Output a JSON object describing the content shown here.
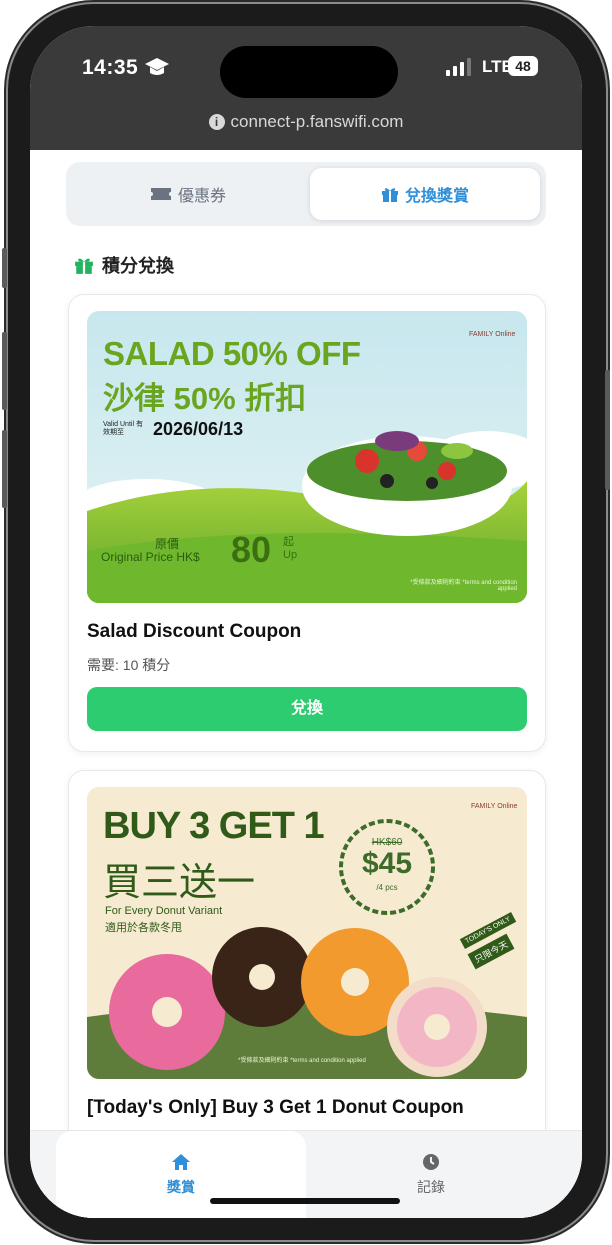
{
  "status_bar": {
    "time": "14:35",
    "network": "LTE",
    "battery": "48"
  },
  "browser": {
    "url": "connect-p.fanswifi.com"
  },
  "tabs": [
    {
      "label": "優惠券",
      "icon": "ticket-icon",
      "active": false
    },
    {
      "label": "兌換獎賞",
      "icon": "gift-icon",
      "active": true
    }
  ],
  "section": {
    "title": "積分兌換",
    "icon": "gift-icon"
  },
  "rewards": [
    {
      "title": "Salad Discount Coupon",
      "requirement": "需要: 10 積分",
      "button_label": "兌換",
      "banner": {
        "headline_en": "SALAD 50% OFF",
        "headline_zh": "沙律 50% 折扣",
        "valid_label": "Valid Until 有效期至",
        "valid_date": "2026/06/13",
        "price_zh": "原價",
        "price_label": "Original Price HK$",
        "price_value": "80",
        "price_suffix_zh": "起",
        "price_suffix_en": "Up",
        "brand": "FAMILY Online",
        "terms": "*受條款及細則約束 *terms and condition applied"
      }
    },
    {
      "title": "[Today's Only] Buy 3 Get 1 Donut Coupon",
      "banner": {
        "headline_en": "BUY 3 GET 1",
        "headline_zh": "買三送一",
        "sub_en": "For Every Donut Variant",
        "sub_zh": "適用於各款冬甩",
        "old_price": "HK$60",
        "price": "$45",
        "price_unit": "/4 pcs",
        "badge_en": "TODAY'S ONLY",
        "badge_zh": "只限今天",
        "brand": "FAMILY Online",
        "terms": "*受條款及細則約束 *terms and condition applied"
      }
    }
  ],
  "bottom_nav": [
    {
      "label": "獎賞",
      "icon": "home-icon",
      "active": true
    },
    {
      "label": "記錄",
      "icon": "clock-icon",
      "active": false
    }
  ],
  "colors": {
    "accent_blue": "#2f8fd8",
    "button_green": "#2ecc71",
    "gift_green": "#22b35e"
  }
}
